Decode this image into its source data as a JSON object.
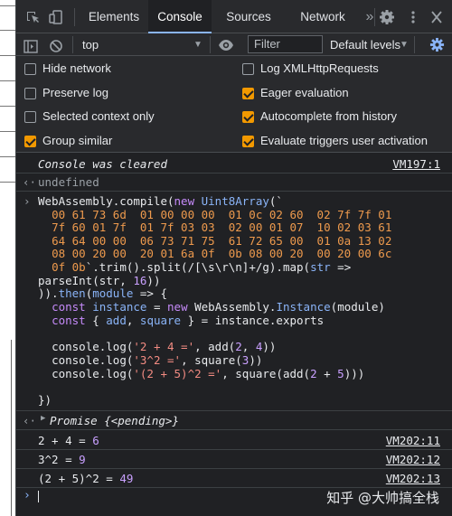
{
  "tabs": [
    "Elements",
    "Console",
    "Sources",
    "Network"
  ],
  "more_tabs": "»",
  "toolbar": {
    "context": "top",
    "filter_placeholder": "Filter",
    "levels": "Default levels"
  },
  "settings": {
    "left": [
      {
        "label": "Hide network",
        "checked": false
      },
      {
        "label": "Preserve log",
        "checked": false
      },
      {
        "label": "Selected context only",
        "checked": false
      },
      {
        "label": "Group similar",
        "checked": true
      }
    ],
    "right": [
      {
        "label": "Log XMLHttpRequests",
        "checked": false
      },
      {
        "label": "Eager evaluation",
        "checked": true
      },
      {
        "label": "Autocomplete from history",
        "checked": true
      },
      {
        "label": "Evaluate triggers user activation",
        "checked": true
      }
    ]
  },
  "console": {
    "cleared_msg": "Console was cleared",
    "cleared_src": "VM197:1",
    "undefined_text": "undefined",
    "code": {
      "l1_a": "WebAssembly.compile(",
      "l1_new": "new",
      "l1_cls": "Uint8Array",
      "l1_b": "(`",
      "hex1": "00 61 73 6d  01 00 00 00  01 0c 02 60  02 7f 7f 01",
      "hex2": "7f 60 01 7f  01 7f 03 03  02 00 01 07  10 02 03 61",
      "hex3": "64 64 00 00  06 73 71 75  61 72 65 00  01 0a 13 02",
      "hex4": "08 00 20 00  20 01 6a 0f  0b 08 00 20  00 20 00 6c",
      "l6_hex": "0f 0b",
      "l6_rest": "`.trim().split(/[\\s\\r\\n]+/g).map(",
      "l6_var": "str",
      "l6_arrow": " =>",
      "l7_a": "parseInt(str, ",
      "l7_num": "16",
      "l7_b": "))",
      "l8_a": ")).",
      "l8_then": "then",
      "l8_b": "(",
      "l8_var": "module",
      "l8_c": " => {",
      "l9_const": "const",
      "l9_var": "instance",
      "l9_a": " = ",
      "l9_new": "new",
      "l9_b": " WebAssembly.",
      "l9_cls": "Instance",
      "l9_c": "(module)",
      "l10_const": "const",
      "l10_a": " { ",
      "l10_v1": "add",
      "l10_b": ", ",
      "l10_v2": "square",
      "l10_c": " } = instance.exports",
      "l12_a": "console.log(",
      "l12_str": "'2 + 4 ='",
      "l12_b": ", add(",
      "l12_n1": "2",
      "l12_c": ", ",
      "l12_n2": "4",
      "l12_d": "))",
      "l13_a": "console.log(",
      "l13_str": "'3^2 ='",
      "l13_b": ", square(",
      "l13_n1": "3",
      "l13_c": "))",
      "l14_a": "console.log(",
      "l14_str": "'(2 + 5)^2 ='",
      "l14_b": ", square(add(",
      "l14_n1": "2",
      "l14_c": " + ",
      "l14_n2": "5",
      "l14_d": ")))",
      "l16": "})"
    },
    "promise_text": "Promise {<pending>}",
    "outputs": [
      {
        "label": "2 + 4 = ",
        "value": "6",
        "src": "VM202:11"
      },
      {
        "label": "3^2 = ",
        "value": "9",
        "src": "VM202:12"
      },
      {
        "label": "(2 + 5)^2 = ",
        "value": "49",
        "src": "VM202:13"
      }
    ],
    "watermark": "知乎 @大帅搞全栈"
  }
}
